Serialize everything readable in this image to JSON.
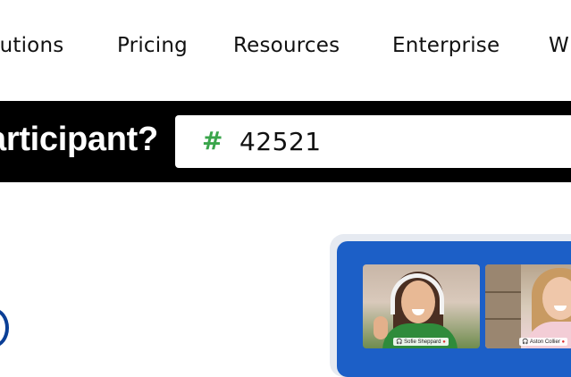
{
  "nav": {
    "items": [
      {
        "label": "lutions"
      },
      {
        "label": "Pricing"
      },
      {
        "label": "Resources"
      },
      {
        "label": "Enterprise"
      },
      {
        "label": "W"
      }
    ]
  },
  "join": {
    "label": "articipant?",
    "code_icon": "hash-icon",
    "code_value": "42521"
  },
  "preview": {
    "participants": [
      {
        "name": "Sofie Sheppard"
      },
      {
        "name": "Aston Collier"
      }
    ]
  },
  "colors": {
    "bar": "#000000",
    "accent_green": "#3aa54b",
    "preview_blue": "#1c5fc7"
  }
}
